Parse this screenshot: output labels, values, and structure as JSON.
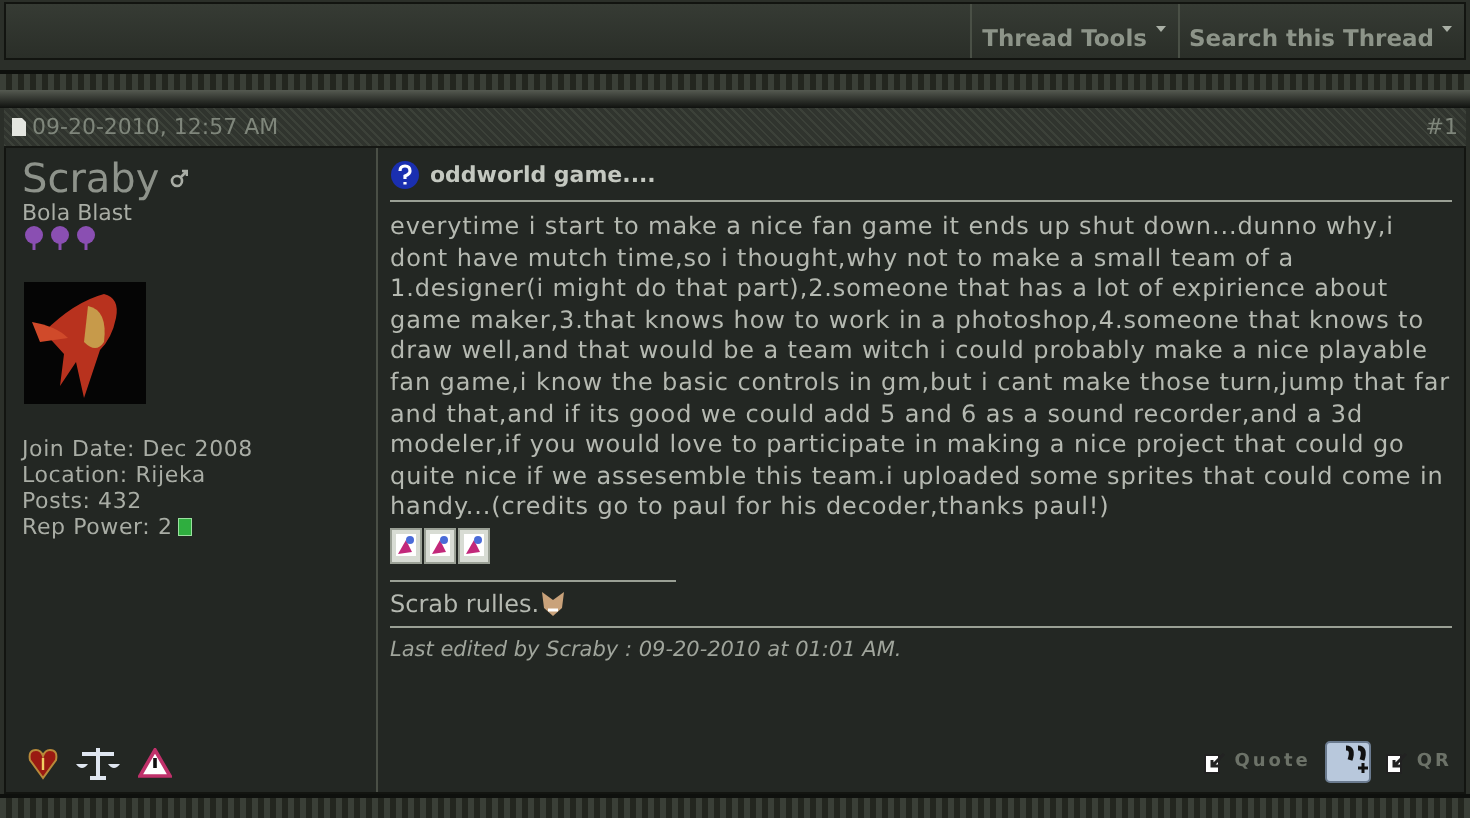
{
  "toolbar": {
    "menus": [
      "Thread Tools",
      "Search this Thread"
    ]
  },
  "post": {
    "date": "09-20-2010, 12:57 AM",
    "number": "#1",
    "user": {
      "name": "Scraby",
      "title": "Bola Blast",
      "details": [
        "Join Date: Dec 2008",
        "Location: Rijeka",
        "Posts: 432",
        "Rep Power: 2"
      ]
    },
    "title": "oddworld game....",
    "message": "everytime i start to make a nice fan game it ends up shut down...dunno why,i dont have mutch time,so i thought,why not to make a small team of a 1.designer(i might do that part),2.someone that has a lot of expirience about game maker,3.that knows how to work in a photoshop,4.someone that knows to draw well,and that would be a team witch i could probably make a nice playable fan game,i know the basic controls in gm,but i cant make those turn,jump that far and that,and if its good we could add 5 and 6 as a sound recorder,and a 3d modeler,if you would love to participate in making a nice project that could go quite nice if we assesemble this team.i uploaded some sprites that could come in handy...(credits go to paul for his decoder,thanks paul!)",
    "signature": "Scrab rulles.",
    "edit_note": "Last edited by Scraby : 09-20-2010 at 01:01 AM.",
    "buttons": [
      {
        "kind": "quote",
        "label": "Quote"
      },
      {
        "kind": "multiquote"
      },
      {
        "kind": "reply",
        "label": "QR"
      }
    ]
  }
}
